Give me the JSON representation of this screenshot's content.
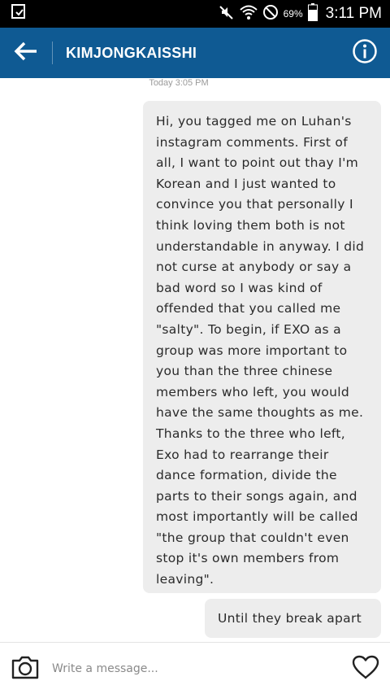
{
  "status_bar": {
    "battery_percent": "69%",
    "time": "3:11 PM",
    "icons": [
      "notification-icon",
      "mute-icon",
      "wifi-icon",
      "do-not-disturb-icon",
      "battery-icon"
    ]
  },
  "header": {
    "back_icon": "arrow-left-icon",
    "title": "KIMJONGKAISSHI",
    "info_icon": "info-icon",
    "background_color": "#0f5a93"
  },
  "conversation": {
    "timestamp": "Today 3:05 PM",
    "messages": [
      {
        "lines": [
          "Hi, you tagged me on Luhan's",
          "instagram comments. First of",
          "all, I want to point out thay I'm",
          "Korean and I just wanted to",
          "convince you that personally I",
          "think loving them both is not",
          "understandable in anyway. I did",
          "not curse at anybody or say a",
          "bad word so I was kind of",
          "offended that you called me",
          "\"salty\". To begin, if EXO as a",
          "group was more important to",
          "you than the three chinese",
          "members who left, you would",
          "have the same thoughts as me.",
          "Thanks to the three who left,",
          "Exo had to rearrange their",
          "dance formation, divide the",
          "parts to their songs again, and",
          "most importantly will be called",
          "\"the group that couldn't even",
          "stop it's own members from",
          "leaving\"."
        ]
      },
      {
        "text": "Until they break apart"
      }
    ]
  },
  "composer": {
    "camera_icon": "camera-icon",
    "placeholder": "Write a message...",
    "heart_icon": "heart-icon"
  }
}
